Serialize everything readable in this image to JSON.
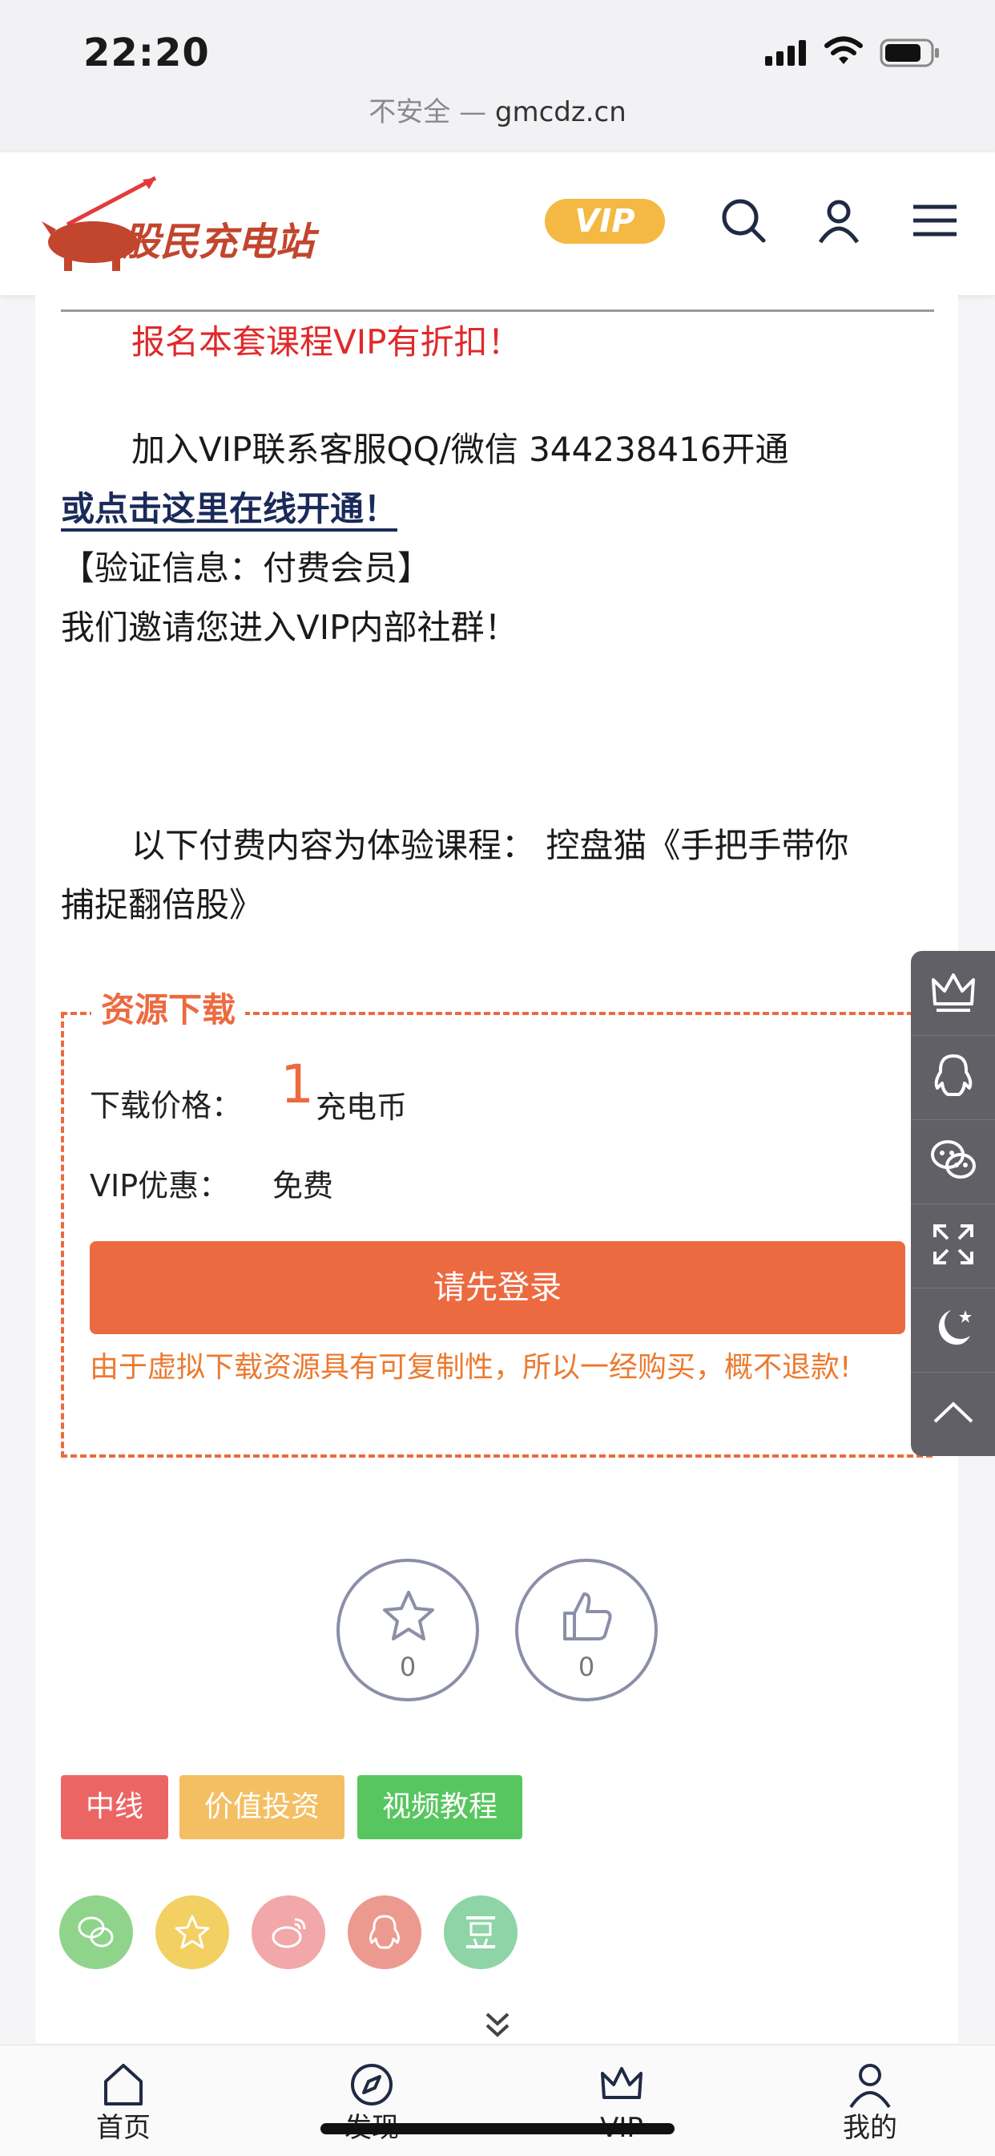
{
  "status_bar": {
    "time": "22:20"
  },
  "url_bar": {
    "security": "不安全",
    "separator": "—",
    "domain": "gmcdz.cn"
  },
  "header": {
    "logo_text": "股民充电站",
    "vip_label": "VIP",
    "icons": [
      "search-icon",
      "user-icon",
      "menu-icon"
    ]
  },
  "article": {
    "discount_line": "报名本套课程VIP有折扣！",
    "join_line": "加入VIP联系客服QQ/微信 344238416开通",
    "online_link": "或点击这里在线开通！",
    "verify_line": "【验证信息：付费会员】",
    "invite_line": "我们邀请您进入VIP内部社群！",
    "trial_line_1": "以下付费内容为体验课程：  控盘猫《手把手带你",
    "trial_line_2": "捕捉翻倍股》"
  },
  "download": {
    "title": "资源下载",
    "price_label": "下载价格：",
    "price_value": "1",
    "price_unit": "充电币",
    "vip_label": "VIP优惠：",
    "vip_value": "免费",
    "login_button": "请先登录",
    "notice": "由于虚拟下载资源具有可复制性，所以一经购买，概不退款!"
  },
  "sidebar": {
    "icons": [
      "crown-icon",
      "qq-icon",
      "wechat-icon",
      "fullscreen-icon",
      "moon-icon",
      "arrow-up-icon"
    ]
  },
  "reactions": {
    "favorite_count": "0",
    "like_count": "0"
  },
  "tags": [
    {
      "label": "中线",
      "color": "#ec6565"
    },
    {
      "label": "价值投资",
      "color": "#f4bf62"
    },
    {
      "label": "视频教程",
      "color": "#58c65f"
    }
  ],
  "share": [
    {
      "icon": "wechat-icon",
      "color": "#8fd48a"
    },
    {
      "icon": "star-icon",
      "color": "#f2d062"
    },
    {
      "icon": "weibo-icon",
      "color": "#f2a8a8"
    },
    {
      "icon": "qq-icon",
      "color": "#ec9a90"
    },
    {
      "icon": "douban-icon",
      "color": "#8ed4a6"
    }
  ],
  "bottom_nav": [
    {
      "label": "首页",
      "icon": "home-icon"
    },
    {
      "label": "发现",
      "icon": "compass-icon"
    },
    {
      "label": "VIP",
      "icon": "crown-icon"
    },
    {
      "label": "我的",
      "icon": "user-icon"
    }
  ]
}
